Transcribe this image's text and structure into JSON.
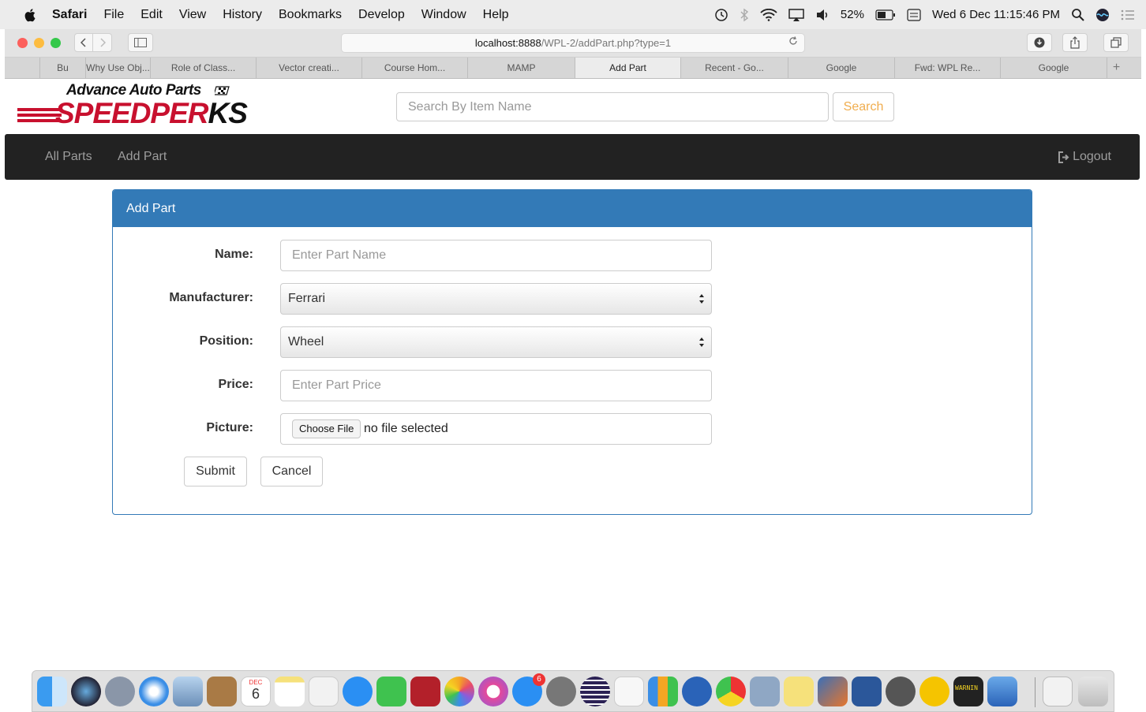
{
  "menubar": {
    "app_name": "Safari",
    "items": [
      "File",
      "Edit",
      "View",
      "History",
      "Bookmarks",
      "Develop",
      "Window",
      "Help"
    ],
    "battery": "52%",
    "clock": "Wed 6 Dec  11:15:46 PM"
  },
  "browser": {
    "url_host": "localhost:8888",
    "url_path": "/WPL-2/addPart.php?type=1",
    "tabs": [
      {
        "label": "Bu"
      },
      {
        "label": "Why Use Obj..."
      },
      {
        "label": "Role of Class..."
      },
      {
        "label": "Vector creati..."
      },
      {
        "label": "Course Hom..."
      },
      {
        "label": "MAMP"
      },
      {
        "label": "Add Part"
      },
      {
        "label": "Recent - Go..."
      },
      {
        "label": "Google"
      },
      {
        "label": "Fwd: WPL Re..."
      },
      {
        "label": "Google"
      }
    ],
    "active_tab": "Add Part",
    "new_tab": "+"
  },
  "header": {
    "logo_top": "Advance Auto Parts",
    "logo_main": "SPEEDPER",
    "logo_main_k": "KS",
    "search_placeholder": "Search By Item Name",
    "search_button": "Search"
  },
  "navbar": {
    "all_parts": "All Parts",
    "add_part": "Add Part",
    "logout": "Logout"
  },
  "panel": {
    "title": "Add Part"
  },
  "form": {
    "name_label": "Name:",
    "name_placeholder": "Enter Part Name",
    "manufacturer_label": "Manufacturer:",
    "manufacturer_value": "Ferrari",
    "position_label": "Position:",
    "position_value": "Wheel",
    "price_label": "Price:",
    "price_placeholder": "Enter Part Price",
    "picture_label": "Picture:",
    "choose_file": "Choose File",
    "file_status": "no file selected",
    "submit": "Submit",
    "cancel": "Cancel"
  },
  "colors": {
    "panel_primary": "#337ab7",
    "navbar_bg": "#222222",
    "search_accent": "#f0ad4e",
    "brand_red": "#c8102e"
  },
  "dock": {
    "apps": [
      "finder-icon",
      "siri-icon",
      "launchpad-icon",
      "safari-icon",
      "preview-icon",
      "contacts-icon",
      "calendar-icon",
      "notes-icon",
      "reminders-icon",
      "messages-icon",
      "facetime-icon",
      "photo-booth-icon",
      "photos-icon",
      "itunes-icon",
      "app-store-icon",
      "system-preferences-icon",
      "eclipse-icon",
      "textedit-icon",
      "numbers-icon",
      "r-icon",
      "chrome-icon",
      "image-capture-icon",
      "stickies-icon",
      "matlab-icon",
      "word-icon",
      "sequel-pro-icon",
      "vlc-icon",
      "console-icon",
      "keynote-icon",
      "document-icon",
      "trash-icon"
    ],
    "app_store_badge": "6",
    "calendar_day": "6",
    "calendar_month": "DEC",
    "console_text": "WARNIN"
  }
}
